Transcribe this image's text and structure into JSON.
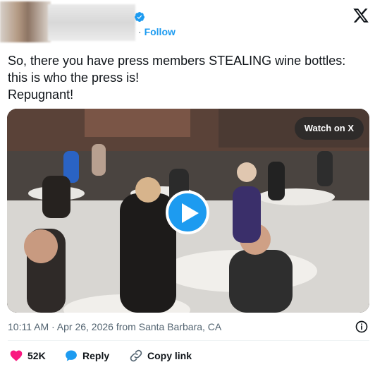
{
  "header": {
    "follow_label": "Follow"
  },
  "tweet": {
    "lines": [
      "So, there you have press members STEALING wine bottles:",
      "this is who the press is!",
      "Repugnant!"
    ]
  },
  "media": {
    "watch_label": "Watch on X"
  },
  "meta": {
    "timestamp": "10:11 AM · Apr 26, 2026 from Santa Barbara, CA"
  },
  "actions": {
    "likes": "52K",
    "reply_label": "Reply",
    "copy_link_label": "Copy link"
  },
  "colors": {
    "accent": "#1d9bf0",
    "like": "#f91880",
    "muted": "#536471"
  }
}
